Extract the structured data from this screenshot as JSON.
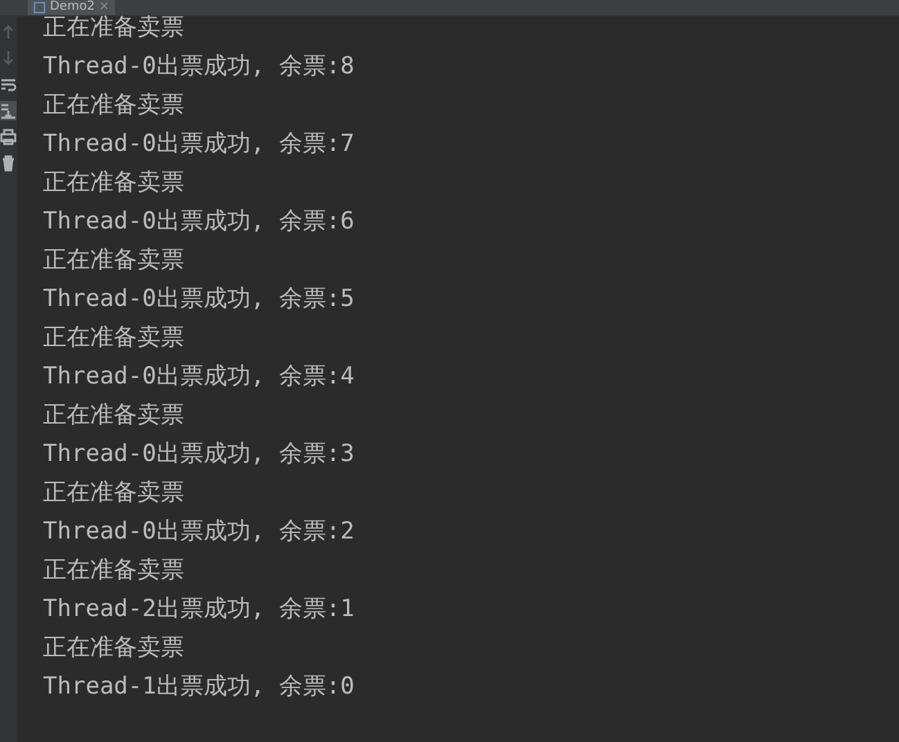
{
  "tab": {
    "label": "Demo2",
    "close": "×"
  },
  "toolbar": [
    {
      "kind": "up",
      "disabled": true,
      "selected": false
    },
    {
      "kind": "down",
      "disabled": true,
      "selected": false
    },
    {
      "kind": "wrap",
      "disabled": false,
      "selected": false
    },
    {
      "kind": "scroll",
      "disabled": false,
      "selected": true
    },
    {
      "kind": "print",
      "disabled": false,
      "selected": false
    },
    {
      "kind": "trash",
      "disabled": false,
      "selected": false
    }
  ],
  "console_lines": [
    "正在准备卖票",
    "Thread-0出票成功, 余票:8",
    "正在准备卖票",
    "Thread-0出票成功, 余票:7",
    "正在准备卖票",
    "Thread-0出票成功, 余票:6",
    "正在准备卖票",
    "Thread-0出票成功, 余票:5",
    "正在准备卖票",
    "Thread-0出票成功, 余票:4",
    "正在准备卖票",
    "Thread-0出票成功, 余票:3",
    "正在准备卖票",
    "Thread-0出票成功, 余票:2",
    "正在准备卖票",
    "Thread-2出票成功, 余票:1",
    "正在准备卖票",
    "Thread-1出票成功, 余票:0"
  ]
}
